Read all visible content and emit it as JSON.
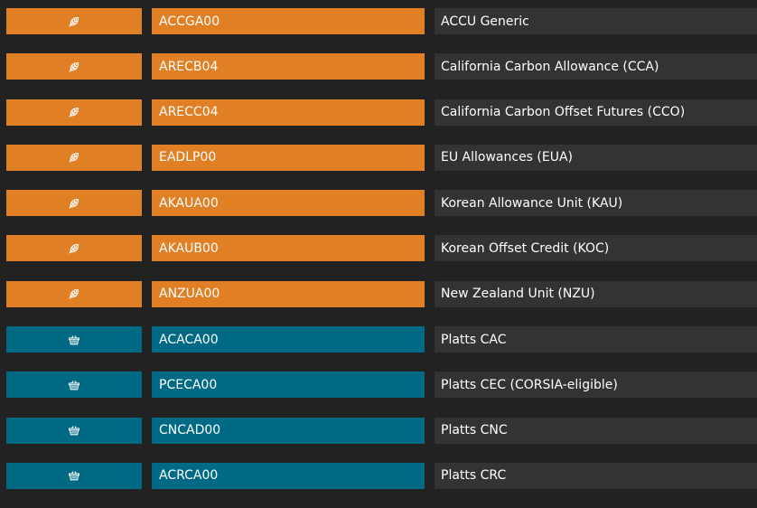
{
  "colors": {
    "background": "#222222",
    "name_cell": "#333333",
    "orange": "#e07f24",
    "teal": "#006a84",
    "text": "#ffffff"
  },
  "rows": [
    {
      "icon": "carbon-leaf-icon",
      "category": "orange",
      "code": "ACCGA00",
      "name": "ACCU Generic"
    },
    {
      "icon": "carbon-leaf-icon",
      "category": "orange",
      "code": "ARECB04",
      "name": "California Carbon Allowance (CCA)"
    },
    {
      "icon": "carbon-leaf-icon",
      "category": "orange",
      "code": "ARECC04",
      "name": "California Carbon Offset Futures (CCO)"
    },
    {
      "icon": "carbon-leaf-icon",
      "category": "orange",
      "code": "EADLP00",
      "name": "EU Allowances (EUA)"
    },
    {
      "icon": "carbon-leaf-icon",
      "category": "orange",
      "code": "AKAUA00",
      "name": "Korean Allowance Unit (KAU)"
    },
    {
      "icon": "carbon-leaf-icon",
      "category": "orange",
      "code": "AKAUB00",
      "name": "Korean Offset Credit (KOC)"
    },
    {
      "icon": "carbon-leaf-icon",
      "category": "orange",
      "code": "ANZUA00",
      "name": "New Zealand Unit (NZU)"
    },
    {
      "icon": "basket-icon",
      "category": "teal",
      "code": "ACACA00",
      "name": "Platts CAC"
    },
    {
      "icon": "basket-icon",
      "category": "teal",
      "code": "PCECA00",
      "name": "Platts CEC (CORSIA-eligible)"
    },
    {
      "icon": "basket-icon",
      "category": "teal",
      "code": "CNCAD00",
      "name": "Platts CNC"
    },
    {
      "icon": "basket-icon",
      "category": "teal",
      "code": "ACRCA00",
      "name": "Platts CRC"
    }
  ]
}
